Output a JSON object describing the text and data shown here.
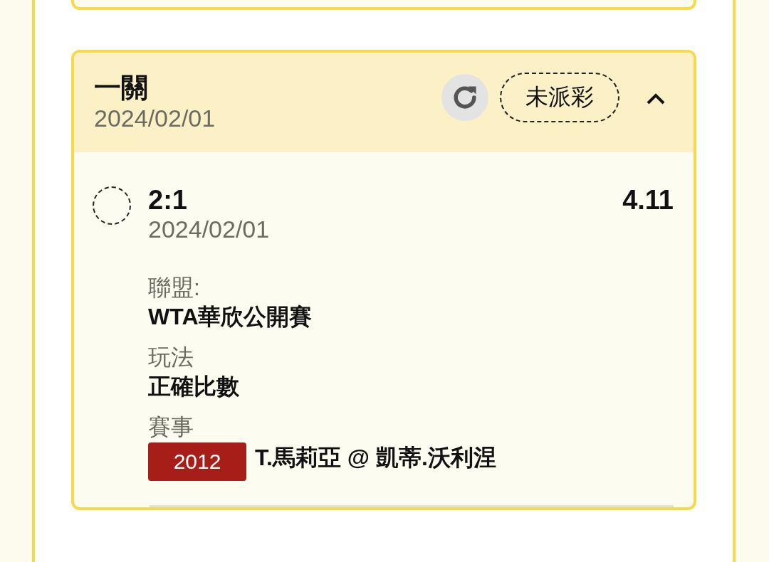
{
  "bet": {
    "title": "一關",
    "date": "2024/02/01",
    "status": "未派彩",
    "expanded": true,
    "selections": [
      {
        "score": "2:1",
        "date": "2024/02/01",
        "odds": "4.11",
        "settled": false,
        "details": [
          {
            "kind": "text",
            "label": "聯盟:",
            "value": "WTA華欣公開賽"
          },
          {
            "kind": "text",
            "label": "玩法",
            "value": "正確比數"
          },
          {
            "kind": "event",
            "label": "賽事",
            "code": "2012",
            "value": "T.馬莉亞 @ 凱蒂.沃利涅"
          }
        ]
      }
    ]
  }
}
